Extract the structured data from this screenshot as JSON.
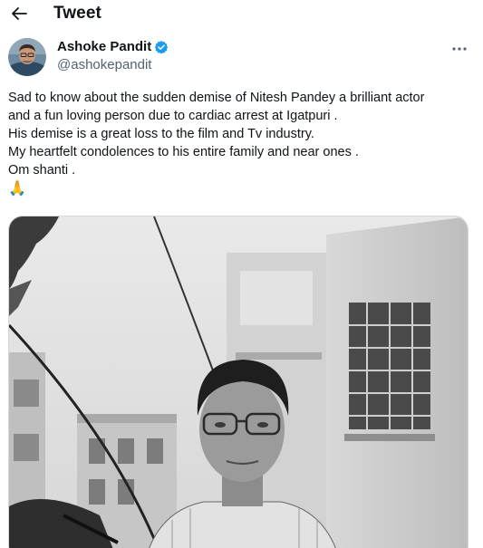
{
  "header": {
    "title": "Tweet",
    "back_icon": "arrow-left-icon"
  },
  "author": {
    "name": "Ashoke Pandit",
    "handle": "@ashokepandit",
    "verified": true,
    "verified_color": "#1d9bf0"
  },
  "tweet": {
    "lines": [
      "Sad to know about the sudden demise of Nitesh Pandey a brilliant actor",
      "and a fun loving person due to cardiac arrest at Igatpuri .",
      "His demise is a great loss to the film and Tv industry.",
      "My heartfelt condolences to his entire family and near ones .",
      "Om shanti ."
    ],
    "emoji": "🙏"
  },
  "media": {
    "style": "black-and-white-photo"
  },
  "colors": {
    "text": "#0f1419",
    "secondary": "#536471",
    "border": "#cfd9de"
  }
}
